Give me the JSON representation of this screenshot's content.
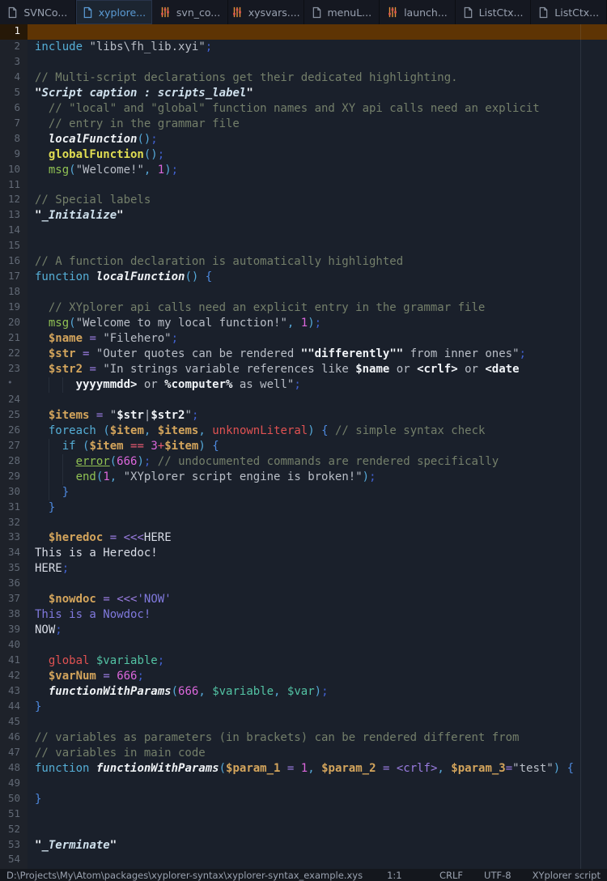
{
  "tabbar": {
    "tabs": [
      {
        "label": "SVNCo...",
        "icon": "file-icon",
        "active": false
      },
      {
        "label": "xyplore...",
        "icon": "file-icon",
        "active": true
      },
      {
        "label": "svn_co...",
        "icon": "config-icon",
        "active": false
      },
      {
        "label": "xysvars....",
        "icon": "config-icon",
        "active": false
      },
      {
        "label": "menuL...",
        "icon": "file-icon",
        "active": false
      },
      {
        "label": "launch...",
        "icon": "config-icon",
        "active": false
      },
      {
        "label": "ListCtx...",
        "icon": "file-icon",
        "active": false
      },
      {
        "label": "ListCtx...",
        "icon": "file-icon",
        "active": false
      }
    ]
  },
  "colors": {
    "cursor_line": "#5e3404",
    "active_tab_text": "#5b9bd5",
    "config_icon_orange": "#e8923a",
    "editor_background": "#1a202b"
  },
  "editor": {
    "rows": [
      {
        "n": "1",
        "cursor": true,
        "tokens": []
      },
      {
        "n": "2",
        "tokens": [
          [
            "kw",
            "include"
          ],
          [
            "txt",
            " "
          ],
          [
            "str",
            "\"libs\\fh_lib.xyi\""
          ],
          [
            "semi",
            ";"
          ]
        ]
      },
      {
        "n": "3",
        "tokens": []
      },
      {
        "n": "4",
        "tokens": [
          [
            "cmt",
            "// Multi-script declarations get their dedicated highlighting."
          ]
        ]
      },
      {
        "n": "5",
        "tokens": [
          [
            "q",
            "\""
          ],
          [
            "lbl",
            "Script caption : scripts_label"
          ],
          [
            "q",
            "\""
          ]
        ]
      },
      {
        "n": "6",
        "tokens": [
          [
            "cmt",
            "  // \"local\" and \"global\" function names and XY api calls need an explicit"
          ]
        ]
      },
      {
        "n": "7",
        "tokens": [
          [
            "cmt",
            "  // entry in the grammar file"
          ]
        ]
      },
      {
        "n": "8",
        "tokens": [
          [
            "txt",
            "  "
          ],
          [
            "fn",
            "localFunction"
          ],
          [
            "pun",
            "()"
          ],
          [
            "semi",
            ";"
          ]
        ]
      },
      {
        "n": "9",
        "tokens": [
          [
            "txt",
            "  "
          ],
          [
            "gfn",
            "globalFunction"
          ],
          [
            "pun",
            "()"
          ],
          [
            "semi",
            ";"
          ]
        ]
      },
      {
        "n": "10",
        "tokens": [
          [
            "txt",
            "  "
          ],
          [
            "api",
            "msg"
          ],
          [
            "pun",
            "("
          ],
          [
            "str",
            "\"Welcome!\""
          ],
          [
            "pun",
            ","
          ],
          [
            "txt",
            " "
          ],
          [
            "num",
            "1"
          ],
          [
            "pun",
            ")"
          ],
          [
            "semi",
            ";"
          ]
        ]
      },
      {
        "n": "11",
        "tokens": []
      },
      {
        "n": "12",
        "tokens": [
          [
            "cmt",
            "// Special labels"
          ]
        ]
      },
      {
        "n": "13",
        "tokens": [
          [
            "q",
            "\""
          ],
          [
            "lbl",
            "_Initialize"
          ],
          [
            "q",
            "\""
          ]
        ]
      },
      {
        "n": "14",
        "tokens": []
      },
      {
        "n": "15",
        "tokens": []
      },
      {
        "n": "16",
        "tokens": [
          [
            "cmt",
            "// A function declaration is automatically highlighted"
          ]
        ]
      },
      {
        "n": "17",
        "tokens": [
          [
            "kw",
            "function"
          ],
          [
            "txt",
            " "
          ],
          [
            "fn",
            "localFunction"
          ],
          [
            "pun",
            "()"
          ],
          [
            "txt",
            " "
          ],
          [
            "brace",
            "{"
          ]
        ]
      },
      {
        "n": "18",
        "tokens": []
      },
      {
        "n": "19",
        "tokens": [
          [
            "cmt",
            "  // XYplorer api calls need an explicit entry in the grammar file"
          ]
        ]
      },
      {
        "n": "20",
        "tokens": [
          [
            "txt",
            "  "
          ],
          [
            "api",
            "msg"
          ],
          [
            "pun",
            "("
          ],
          [
            "str",
            "\"Welcome to my local function!\""
          ],
          [
            "pun",
            ","
          ],
          [
            "txt",
            " "
          ],
          [
            "num",
            "1"
          ],
          [
            "pun",
            ")"
          ],
          [
            "semi",
            ";"
          ]
        ]
      },
      {
        "n": "21",
        "tokens": [
          [
            "txt",
            "  "
          ],
          [
            "var",
            "$name"
          ],
          [
            "txt",
            " "
          ],
          [
            "op",
            "="
          ],
          [
            "txt",
            " "
          ],
          [
            "str",
            "\"Filehero\""
          ],
          [
            "semi",
            ";"
          ]
        ]
      },
      {
        "n": "22",
        "tokens": [
          [
            "txt",
            "  "
          ],
          [
            "var",
            "$str"
          ],
          [
            "txt",
            " "
          ],
          [
            "op",
            "="
          ],
          [
            "txt",
            " "
          ],
          [
            "str",
            "\"Outer quotes can be rendered "
          ],
          [
            "strb",
            "\"\"differently\"\""
          ],
          [
            "str",
            " from inner ones\""
          ],
          [
            "semi",
            ";"
          ]
        ]
      },
      {
        "n": "23",
        "tokens": [
          [
            "txt",
            "  "
          ],
          [
            "var",
            "$str2"
          ],
          [
            "txt",
            " "
          ],
          [
            "op",
            "="
          ],
          [
            "txt",
            " "
          ],
          [
            "str",
            "\"In strings variable references like "
          ],
          [
            "strb",
            "$name"
          ],
          [
            "str",
            " or "
          ],
          [
            "strb",
            "<crlf>"
          ],
          [
            "str",
            " or "
          ],
          [
            "strb",
            "<date"
          ]
        ]
      },
      {
        "n": "•",
        "wrap": true,
        "tokens": [
          [
            "txt",
            "      "
          ],
          [
            "strb",
            "yyyymmdd>"
          ],
          [
            "str",
            " or "
          ],
          [
            "strb",
            "%computer%"
          ],
          [
            "str",
            " as well\""
          ],
          [
            "semi",
            ";"
          ]
        ]
      },
      {
        "n": "24",
        "tokens": []
      },
      {
        "n": "25",
        "tokens": [
          [
            "txt",
            "  "
          ],
          [
            "var",
            "$items"
          ],
          [
            "txt",
            " "
          ],
          [
            "op",
            "="
          ],
          [
            "txt",
            " "
          ],
          [
            "str",
            "\""
          ],
          [
            "strb",
            "$str"
          ],
          [
            "str",
            "|"
          ],
          [
            "strb",
            "$str2"
          ],
          [
            "str",
            "\""
          ],
          [
            "semi",
            ";"
          ]
        ]
      },
      {
        "n": "26",
        "tokens": [
          [
            "txt",
            "  "
          ],
          [
            "kw",
            "foreach"
          ],
          [
            "txt",
            " "
          ],
          [
            "pun",
            "("
          ],
          [
            "var",
            "$item"
          ],
          [
            "pun",
            ","
          ],
          [
            "txt",
            " "
          ],
          [
            "var",
            "$items"
          ],
          [
            "pun",
            ","
          ],
          [
            "txt",
            " "
          ],
          [
            "red",
            "unknownLiteral"
          ],
          [
            "pun",
            ")"
          ],
          [
            "txt",
            " "
          ],
          [
            "brace",
            "{"
          ],
          [
            "txt",
            " "
          ],
          [
            "cmt",
            "// simple syntax check"
          ]
        ]
      },
      {
        "n": "27",
        "tokens": [
          [
            "txt",
            "    "
          ],
          [
            "kw",
            "if"
          ],
          [
            "txt",
            " "
          ],
          [
            "pun",
            "("
          ],
          [
            "var",
            "$item"
          ],
          [
            "txt",
            " "
          ],
          [
            "opr",
            "=="
          ],
          [
            "txt",
            " "
          ],
          [
            "num",
            "3"
          ],
          [
            "opr",
            "+"
          ],
          [
            "var",
            "$item"
          ],
          [
            "pun",
            ")"
          ],
          [
            "txt",
            " "
          ],
          [
            "brace",
            "{"
          ]
        ]
      },
      {
        "n": "28",
        "tokens": [
          [
            "txt",
            "      "
          ],
          [
            "apiu",
            "error"
          ],
          [
            "pun",
            "("
          ],
          [
            "num",
            "666"
          ],
          [
            "pun",
            ")"
          ],
          [
            "semi",
            ";"
          ],
          [
            "txt",
            " "
          ],
          [
            "cmt",
            "// undocumented commands are rendered specifically"
          ]
        ]
      },
      {
        "n": "29",
        "tokens": [
          [
            "txt",
            "      "
          ],
          [
            "api",
            "end"
          ],
          [
            "pun",
            "("
          ],
          [
            "num",
            "1"
          ],
          [
            "pun",
            ","
          ],
          [
            "txt",
            " "
          ],
          [
            "str",
            "\"XYplorer script engine is broken!\""
          ],
          [
            "pun",
            ")"
          ],
          [
            "semi",
            ";"
          ]
        ]
      },
      {
        "n": "30",
        "tokens": [
          [
            "txt",
            "    "
          ],
          [
            "brace",
            "}"
          ]
        ]
      },
      {
        "n": "31",
        "tokens": [
          [
            "txt",
            "  "
          ],
          [
            "brace",
            "}"
          ]
        ]
      },
      {
        "n": "32",
        "tokens": []
      },
      {
        "n": "33",
        "tokens": [
          [
            "txt",
            "  "
          ],
          [
            "var",
            "$heredoc"
          ],
          [
            "txt",
            " "
          ],
          [
            "op",
            "="
          ],
          [
            "txt",
            " "
          ],
          [
            "op",
            "<<<"
          ],
          [
            "hdoc",
            "HERE"
          ]
        ]
      },
      {
        "n": "34",
        "tokens": [
          [
            "hdoc",
            "This is a Heredoc!"
          ]
        ]
      },
      {
        "n": "35",
        "tokens": [
          [
            "hdoc",
            "HERE"
          ],
          [
            "semi",
            ";"
          ]
        ]
      },
      {
        "n": "36",
        "tokens": []
      },
      {
        "n": "37",
        "tokens": [
          [
            "txt",
            "  "
          ],
          [
            "var",
            "$nowdoc"
          ],
          [
            "txt",
            " "
          ],
          [
            "op",
            "="
          ],
          [
            "txt",
            " "
          ],
          [
            "op",
            "<<<"
          ],
          [
            "ndoc",
            "'NOW'"
          ]
        ]
      },
      {
        "n": "38",
        "tokens": [
          [
            "ndoc",
            "This is a Nowdoc!"
          ]
        ]
      },
      {
        "n": "39",
        "tokens": [
          [
            "hdoc",
            "NOW"
          ],
          [
            "semi",
            ";"
          ]
        ]
      },
      {
        "n": "40",
        "tokens": []
      },
      {
        "n": "41",
        "tokens": [
          [
            "txt",
            "  "
          ],
          [
            "red",
            "global"
          ],
          [
            "txt",
            " "
          ],
          [
            "tvar",
            "$variable"
          ],
          [
            "semi",
            ";"
          ]
        ]
      },
      {
        "n": "42",
        "tokens": [
          [
            "txt",
            "  "
          ],
          [
            "var",
            "$varNum"
          ],
          [
            "txt",
            " "
          ],
          [
            "op",
            "="
          ],
          [
            "txt",
            " "
          ],
          [
            "num",
            "666"
          ],
          [
            "semi",
            ";"
          ]
        ]
      },
      {
        "n": "43",
        "tokens": [
          [
            "txt",
            "  "
          ],
          [
            "fn",
            "functionWithParams"
          ],
          [
            "pun",
            "("
          ],
          [
            "num",
            "666"
          ],
          [
            "pun",
            ","
          ],
          [
            "txt",
            " "
          ],
          [
            "tvar",
            "$variable"
          ],
          [
            "pun",
            ","
          ],
          [
            "txt",
            " "
          ],
          [
            "tvar",
            "$var"
          ],
          [
            "pun",
            ")"
          ],
          [
            "semi",
            ";"
          ]
        ]
      },
      {
        "n": "44",
        "tokens": [
          [
            "brace",
            "}"
          ]
        ]
      },
      {
        "n": "45",
        "tokens": []
      },
      {
        "n": "46",
        "tokens": [
          [
            "cmt",
            "// variables as parameters (in brackets) can be rendered different from"
          ]
        ]
      },
      {
        "n": "47",
        "tokens": [
          [
            "cmt",
            "// variables in main code"
          ]
        ]
      },
      {
        "n": "48",
        "tokens": [
          [
            "kw",
            "function"
          ],
          [
            "txt",
            " "
          ],
          [
            "fn",
            "functionWithParams"
          ],
          [
            "pun",
            "("
          ],
          [
            "var",
            "$param_1"
          ],
          [
            "txt",
            " "
          ],
          [
            "op",
            "="
          ],
          [
            "txt",
            " "
          ],
          [
            "num",
            "1"
          ],
          [
            "pun",
            ","
          ],
          [
            "txt",
            " "
          ],
          [
            "var",
            "$param_2"
          ],
          [
            "txt",
            " "
          ],
          [
            "op",
            "="
          ],
          [
            "txt",
            " "
          ],
          [
            "op",
            "<crlf>"
          ],
          [
            "pun",
            ","
          ],
          [
            "txt",
            " "
          ],
          [
            "var",
            "$param_3"
          ],
          [
            "op",
            "="
          ],
          [
            "str",
            "\"test\""
          ],
          [
            "pun",
            ")"
          ],
          [
            "txt",
            " "
          ],
          [
            "brace",
            "{"
          ]
        ]
      },
      {
        "n": "49",
        "tokens": []
      },
      {
        "n": "50",
        "tokens": [
          [
            "brace",
            "}"
          ]
        ]
      },
      {
        "n": "51",
        "tokens": []
      },
      {
        "n": "52",
        "tokens": []
      },
      {
        "n": "53",
        "tokens": [
          [
            "q",
            "\""
          ],
          [
            "lbl",
            "_Terminate"
          ],
          [
            "q",
            "\""
          ]
        ]
      },
      {
        "n": "54",
        "tokens": []
      }
    ]
  },
  "statusbar": {
    "path": "D:\\Projects\\My\\Atom\\packages\\xyplorer-syntax\\xyplorer-syntax_example.xys",
    "cursor_position": "1:1",
    "line_ending": "CRLF",
    "encoding": "UTF-8",
    "grammar": "XYplorer script"
  }
}
